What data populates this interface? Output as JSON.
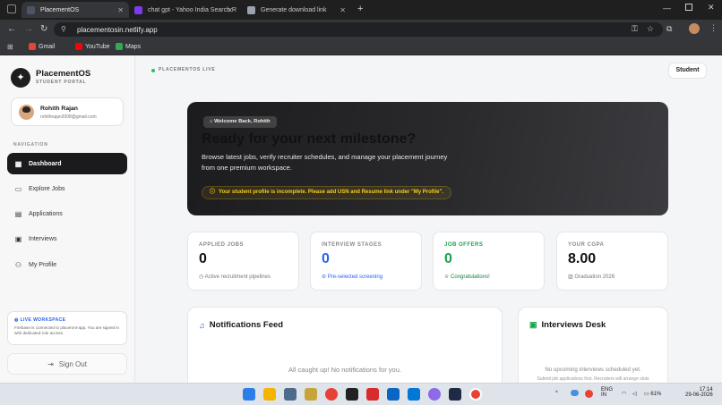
{
  "browser": {
    "tabs": [
      {
        "title": "PlacementOS",
        "color": "#4b5563"
      },
      {
        "title": "chat gpt - Yahoo India Search R",
        "color": "#7c3aed"
      },
      {
        "title": "Generate download link",
        "color": "#9ca3af"
      }
    ],
    "url": "placementosin.netlify.app",
    "bookmarks": [
      {
        "label": "Gmail",
        "color": "#ea4335"
      },
      {
        "label": "YouTube",
        "color": "#ff0000"
      },
      {
        "label": "Maps",
        "color": "#34a853"
      }
    ],
    "new_tab": "+",
    "profile": "R"
  },
  "sidebar": {
    "brand": "PlacementOS",
    "brand_sub": "STUDENT PORTAL",
    "user": {
      "name": "Rohith Rajan",
      "email": "rohithrajan2008@gmail.com"
    },
    "nav_label": "NAVIGATION",
    "items": [
      {
        "label": "Dashboard",
        "icon": "dashboard-icon",
        "active": true
      },
      {
        "label": "Explore Jobs",
        "icon": "briefcase-icon",
        "active": false
      },
      {
        "label": "Applications",
        "icon": "document-icon",
        "active": false
      },
      {
        "label": "Interviews",
        "icon": "calendar-icon",
        "active": false
      },
      {
        "label": "My Profile",
        "icon": "user-icon",
        "active": false
      }
    ],
    "workspace": {
      "title": "LIVE WORKSPACE",
      "text": "Firebase is connected to placemnt-app. You are signed in with dedicated role access."
    },
    "signout": "Sign Out"
  },
  "header": {
    "live": "PLACEMENTOS LIVE",
    "role": "Student"
  },
  "hero": {
    "welcome": "Welcome Back, Rohith",
    "title": "Ready for your next milestone?",
    "desc": "Browse latest jobs, verify recruiter schedules, and manage your placement journey from one premium workspace.",
    "warning": "Your student profile is incomplete. Please add USN and Resume link under \"My Profile\"."
  },
  "stats": [
    {
      "label": "APPLIED JOBS",
      "value": "0",
      "sub": "Active recruitment pipelines",
      "label_color": "#888888",
      "value_color": "#111111",
      "sub_color": "#777777"
    },
    {
      "label": "INTERVIEW STAGES",
      "value": "0",
      "sub": "Pre-selected screening",
      "label_color": "#888888",
      "value_color": "#2563eb",
      "sub_color": "#2563eb"
    },
    {
      "label": "JOB OFFERS",
      "value": "0",
      "sub": "Congratulations!",
      "label_color": "#16a34a",
      "value_color": "#16a34a",
      "sub_color": "#15803d"
    },
    {
      "label": "YOUR CGPA",
      "value": "8.00",
      "sub": "Graduation 2026",
      "label_color": "#888888",
      "value_color": "#111111",
      "sub_color": "#777777"
    }
  ],
  "notifications": {
    "title": "Notifications Feed",
    "empty": "All caught up! No notifications for you."
  },
  "interviews": {
    "title": "Interviews Desk",
    "empty": "No upcoming interviews scheduled yet.",
    "hint": "Submit job applications first. Recruiters will arrange slots"
  },
  "taskbar": {
    "lang": "ENG",
    "region": "IN",
    "battery": "61%",
    "time": "17:14",
    "date": "29-06-2026"
  }
}
